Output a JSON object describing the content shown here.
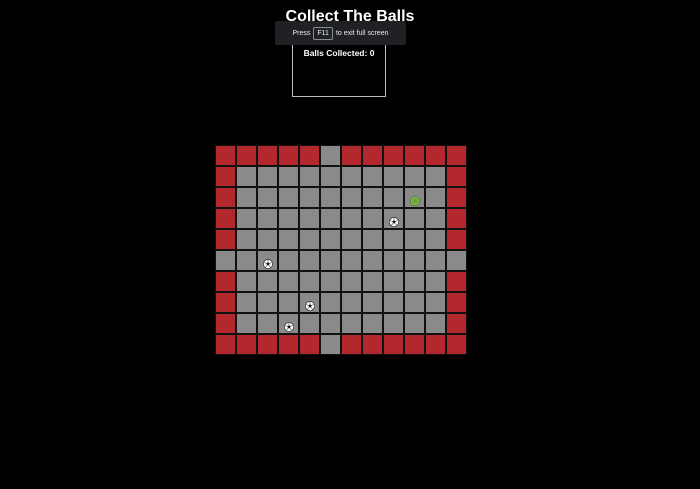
{
  "game": {
    "title": "Collect The Balls",
    "score_label": "Balls Collected: 0"
  },
  "fullscreen_toast": {
    "press": "Press",
    "key": "F11",
    "suffix": "to exit full screen"
  },
  "colors": {
    "wall": "#b3282c",
    "floor": "#8a8a8a",
    "player": "#8bc34a"
  },
  "board": {
    "columns": 12,
    "rows": 10,
    "map": [
      "WWWWW.WWWWWW",
      "W..........W",
      "W..........W",
      "W..........W",
      "W..........W",
      "............",
      "W..........W",
      "W..........W",
      "W..........W",
      "WWWWW.WWWWWW"
    ],
    "balls": [
      {
        "row": 3,
        "col": 8
      },
      {
        "row": 5,
        "col": 2
      },
      {
        "row": 7,
        "col": 4
      },
      {
        "row": 8,
        "col": 3
      }
    ],
    "player": {
      "row": 2,
      "col": 9
    },
    "ball_icon": "soccer-ball-icon",
    "player_icon": "player-green-ball-icon"
  }
}
